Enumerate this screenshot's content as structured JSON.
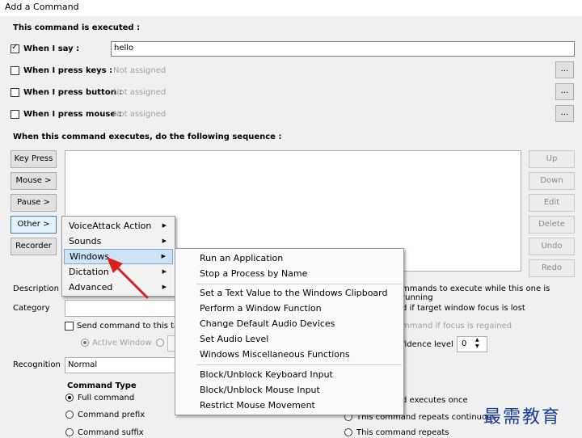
{
  "window": {
    "title": "Add a Command"
  },
  "trigger": {
    "heading": "This command is executed :",
    "when_i_say": {
      "label": "When I say :",
      "value": "hello"
    },
    "press_keys": {
      "label": "When I press keys :",
      "value": "Not assigned",
      "btn": "..."
    },
    "press_button": {
      "label": "When I press button :",
      "value": "Not assigned",
      "btn": "..."
    },
    "press_mouse": {
      "label": "When I press mouse :",
      "value": "Not assigned",
      "btn": "..."
    }
  },
  "sequence": {
    "heading": "When this command executes, do the following sequence :",
    "left_buttons": [
      "Key Press",
      "Mouse >",
      "Pause >",
      "Other >",
      "Recorder"
    ],
    "right_buttons": [
      "Up",
      "Down",
      "Edit",
      "Delete",
      "Undo",
      "Redo"
    ]
  },
  "bottom": {
    "description_label": "Description",
    "category_label": "Category",
    "send_to_label": "Send command to this targ",
    "active_window": "Active Window",
    "recognition_label": "Recognition",
    "recognition_value": "Normal",
    "command_type_heading": "Command Type",
    "command_types": [
      "Full command",
      "Command prefix",
      "Command suffix"
    ],
    "right_text_1": "mmands to execute while this one is running",
    "right_text_2": "d if target window focus is lost",
    "right_text_3": "mmand if focus is regained",
    "confidence_label": "fidence level",
    "confidence_value": "0",
    "repeat_1": "d executes once",
    "repeat_2": "This command repeats continuous",
    "repeat_3": "This command repeats"
  },
  "menu": {
    "items": [
      "VoiceAttack Action",
      "Sounds",
      "Windows",
      "Dictation",
      "Advanced"
    ],
    "highlighted": "Windows"
  },
  "submenu": {
    "group1": [
      "Run an Application",
      "Stop a Process by Name"
    ],
    "group2": [
      "Set a Text Value to the Windows Clipboard",
      "Perform a Window Function",
      "Change Default Audio Devices",
      "Set Audio Level",
      "Windows Miscellaneous Functions"
    ],
    "group3": [
      "Block/Unblock Keyboard Input",
      "Block/Unblock Mouse Input",
      "Restrict Mouse Movement"
    ]
  },
  "watermark": {
    "text": "最需教育"
  },
  "colors": {
    "highlight": "#cde4f7",
    "arrow": "#d9201c",
    "watermark": "#1a3d9a"
  }
}
